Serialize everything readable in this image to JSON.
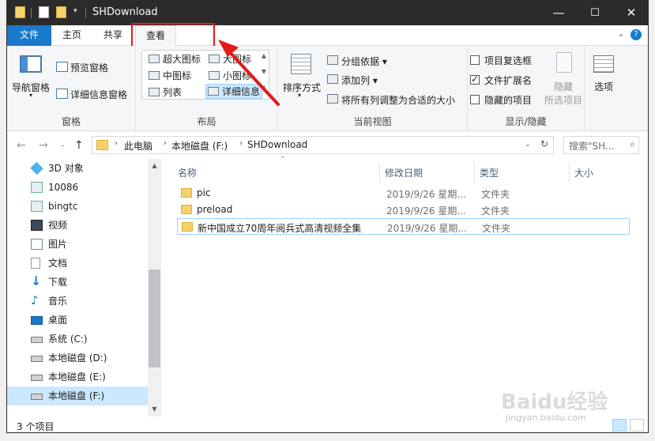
{
  "window": {
    "title": "SHDownload",
    "controls": {
      "minimize": "—",
      "maximize": "☐",
      "close": "✕"
    }
  },
  "tabs": [
    {
      "label": "文件"
    },
    {
      "label": "主页"
    },
    {
      "label": "共享"
    },
    {
      "label": "查看"
    }
  ],
  "ribbon": {
    "pane": {
      "label": "窗格",
      "nav_pane": "导航窗格",
      "preview": "预览窗格",
      "details": "详细信息窗格"
    },
    "layout": {
      "label": "布局",
      "items": [
        "超大图标",
        "大图标",
        "中图标",
        "小图标",
        "列表",
        "详细信息"
      ]
    },
    "current_view": {
      "label": "当前视图",
      "sort": "排序方式",
      "group": "分组依据",
      "add_col": "添加列",
      "fit": "将所有列调整为合适的大小"
    },
    "show_hide": {
      "label": "显示/隐藏",
      "item_checkbox": "项目复选框",
      "ext": "文件扩展名",
      "hidden": "隐藏的项目",
      "hide": "隐藏",
      "selected": "所选项目"
    },
    "options": {
      "label": "选项"
    }
  },
  "address": {
    "crumbs": [
      "此电脑",
      "本地磁盘 (F:)",
      "SHDownload"
    ],
    "search_placeholder": "搜索\"SH..."
  },
  "nav": [
    {
      "label": "3D 对象"
    },
    {
      "label": "10086"
    },
    {
      "label": "bingtc"
    },
    {
      "label": "视频"
    },
    {
      "label": "图片"
    },
    {
      "label": "文档"
    },
    {
      "label": "下载"
    },
    {
      "label": "音乐"
    },
    {
      "label": "桌面"
    },
    {
      "label": "系统 (C:)"
    },
    {
      "label": "本地磁盘 (D:)"
    },
    {
      "label": "本地磁盘 (E:)"
    },
    {
      "label": "本地磁盘 (F:)"
    }
  ],
  "columns": {
    "name": "名称",
    "date": "修改日期",
    "type": "类型",
    "size": "大小"
  },
  "files": [
    {
      "name": "pic",
      "date": "2019/9/26 星期...",
      "type": "文件夹"
    },
    {
      "name": "preload",
      "date": "2019/9/26 星期...",
      "type": "文件夹"
    },
    {
      "name": "新中国成立70周年阅兵式高清视频全集",
      "date": "2019/9/26 星期...",
      "type": "文件夹"
    }
  ],
  "status": {
    "count": "3 个项目"
  },
  "watermark": {
    "brand": "Baidu经验",
    "url": "jingyan.baidu.com"
  },
  "colors": {
    "accent": "#1979ca",
    "titlebar": "#2b2b2b",
    "highlight": "#e21a1a",
    "selection": "#cce8ff"
  }
}
